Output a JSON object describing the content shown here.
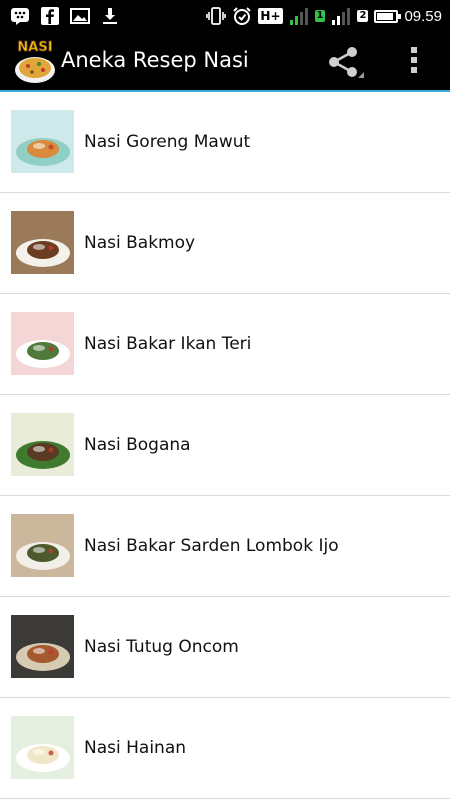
{
  "status_bar": {
    "time": "09.59",
    "network_label": "H+",
    "sim1": "1",
    "sim2": "2",
    "battery_level": 0.8,
    "icons": [
      "bbm-icon",
      "facebook-icon",
      "gallery-icon",
      "download-icon",
      "vibrate-icon",
      "alarm-icon",
      "signal-icon",
      "battery-icon"
    ]
  },
  "action_bar": {
    "title": "Aneka Resep Nasi",
    "logo_text": "NASI",
    "icons": [
      "share-icon",
      "overflow-menu-icon"
    ]
  },
  "recipes": [
    {
      "label": "Nasi Goreng Mawut",
      "bg": "#cfe8ea",
      "plate": "#8fcfc6",
      "food": "#d98a3c"
    },
    {
      "label": "Nasi Bakmoy",
      "bg": "#9b7a5a",
      "plate": "#f4f1ea",
      "food": "#6b3e22"
    },
    {
      "label": "Nasi Bakar Ikan Teri",
      "bg": "#f4d6d6",
      "plate": "#ffffff",
      "food": "#4f7a3a"
    },
    {
      "label": "Nasi Bogana",
      "bg": "#e9ecd8",
      "plate": "#3f7a2e",
      "food": "#5a3a22"
    },
    {
      "label": "Nasi Bakar Sarden Lombok Ijo",
      "bg": "#cbb89c",
      "plate": "#f2efe8",
      "food": "#4d5a2e"
    },
    {
      "label": "Nasi Tutug Oncom",
      "bg": "#3b3a36",
      "plate": "#d8cbb3",
      "food": "#a4592e"
    },
    {
      "label": "Nasi Hainan",
      "bg": "#e4efe0",
      "plate": "#ffffff",
      "food": "#f0e6c8"
    }
  ]
}
